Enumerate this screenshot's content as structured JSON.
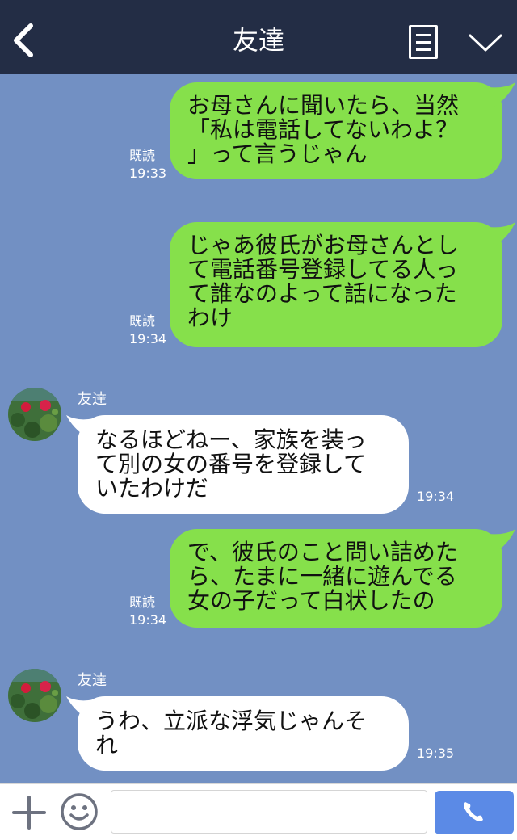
{
  "header": {
    "title": "友達",
    "back_icon": "back-chevron-icon",
    "menu_icon": "menu-icon",
    "collapse_icon": "chevron-down-icon"
  },
  "contact": {
    "name": "友達",
    "avatar_icon": "flower-avatar"
  },
  "messages": [
    {
      "side": "right",
      "lines": [
        "お母さんに聞いたら、当然",
        "「私は電話してないわよ？",
        "」って言うじゃん"
      ],
      "read": "既読",
      "time": "19:33"
    },
    {
      "side": "right",
      "lines": [
        "じゃあ彼氏がお母さんとし",
        "て電話番号登録してる人っ",
        "て誰なのよって話になった",
        "わけ"
      ],
      "read": "既読",
      "time": "19:34"
    },
    {
      "side": "left",
      "sender": "友達",
      "lines": [
        "なるほどねー、家族を装っ",
        "て別の女の番号を登録して",
        "いたわけだ"
      ],
      "time": "19:34"
    },
    {
      "side": "right",
      "lines": [
        "で、彼氏のこと問い詰めた",
        "ら、たまに一緒に遊んでる",
        "女の子だって白状したの"
      ],
      "read": "既読",
      "time": "19:34"
    },
    {
      "side": "left",
      "sender": "友達",
      "lines": [
        "うわ、立派な浮気じゃんそ",
        "れ"
      ],
      "time": "19:35"
    }
  ],
  "footer": {
    "input_value": "",
    "input_placeholder": "",
    "plus_icon": "plus-icon",
    "emoji_icon": "emoji-icon",
    "send_icon": "phone-icon"
  },
  "colors": {
    "header_bg": "#232d45",
    "chat_bg": "#7290c3",
    "right_bubble": "#86e04b",
    "left_bubble": "#ffffff",
    "send_button": "#5b8ae6"
  }
}
